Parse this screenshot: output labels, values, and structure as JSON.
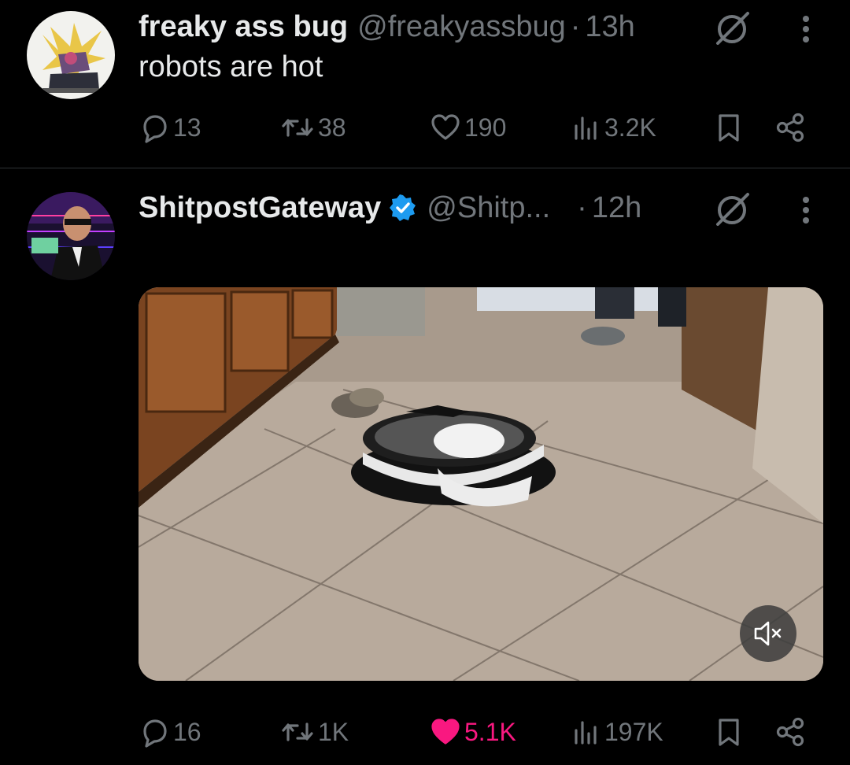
{
  "tweets": [
    {
      "name": "freaky ass bug",
      "handle": "@freakyassbug",
      "dot": "·",
      "time": "13h",
      "text": "robots are hot",
      "verified": false,
      "stats": {
        "replies": "13",
        "retweets": "38",
        "likes": "190",
        "views": "3.2K"
      },
      "liked": false
    },
    {
      "name": "ShitpostGateway",
      "handle": "@Shitp...",
      "dot": "·",
      "time": "12h",
      "text": "",
      "verified": true,
      "stats": {
        "replies": "16",
        "retweets": "1K",
        "likes": "5.1K",
        "views": "197K"
      },
      "liked": true
    }
  ],
  "colors": {
    "background": "#000000",
    "text_primary": "#e7e9ea",
    "text_secondary": "#71767b",
    "like_active": "#f91880",
    "verified_blue": "#1d9bf0",
    "divider": "#2f3336"
  },
  "icons": [
    "reply-icon",
    "retweet-icon",
    "like-icon",
    "views-icon",
    "bookmark-icon",
    "share-icon",
    "grok-icon",
    "more-icon",
    "verified-icon",
    "mute-icon"
  ]
}
